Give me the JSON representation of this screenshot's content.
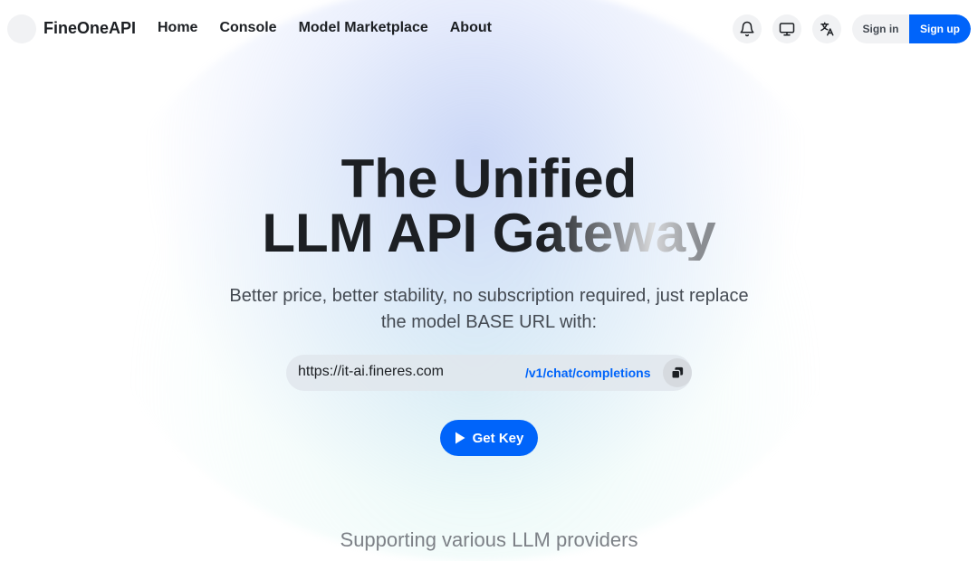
{
  "brand": {
    "name": "FineOneAPI"
  },
  "nav": {
    "links": [
      "Home",
      "Console",
      "Model Marketplace",
      "About"
    ]
  },
  "header_icons": [
    "bell-icon",
    "monitor-icon",
    "translate-icon"
  ],
  "auth": {
    "sign_in": "Sign in",
    "sign_up": "Sign up"
  },
  "hero": {
    "title_line1": "The Unified",
    "title_line2": "LLM API Gateway",
    "subtitle": "Better price, better stability, no subscription required, just replace the model BASE URL with:",
    "base_url": "https://it-ai.fineres.com",
    "endpoint_path": "/v1/chat/completions",
    "cta": "Get Key"
  },
  "providers_heading": "Supporting various LLM providers",
  "colors": {
    "accent": "#0064fa",
    "text": "#1c1f23",
    "muted": "#444a52"
  }
}
